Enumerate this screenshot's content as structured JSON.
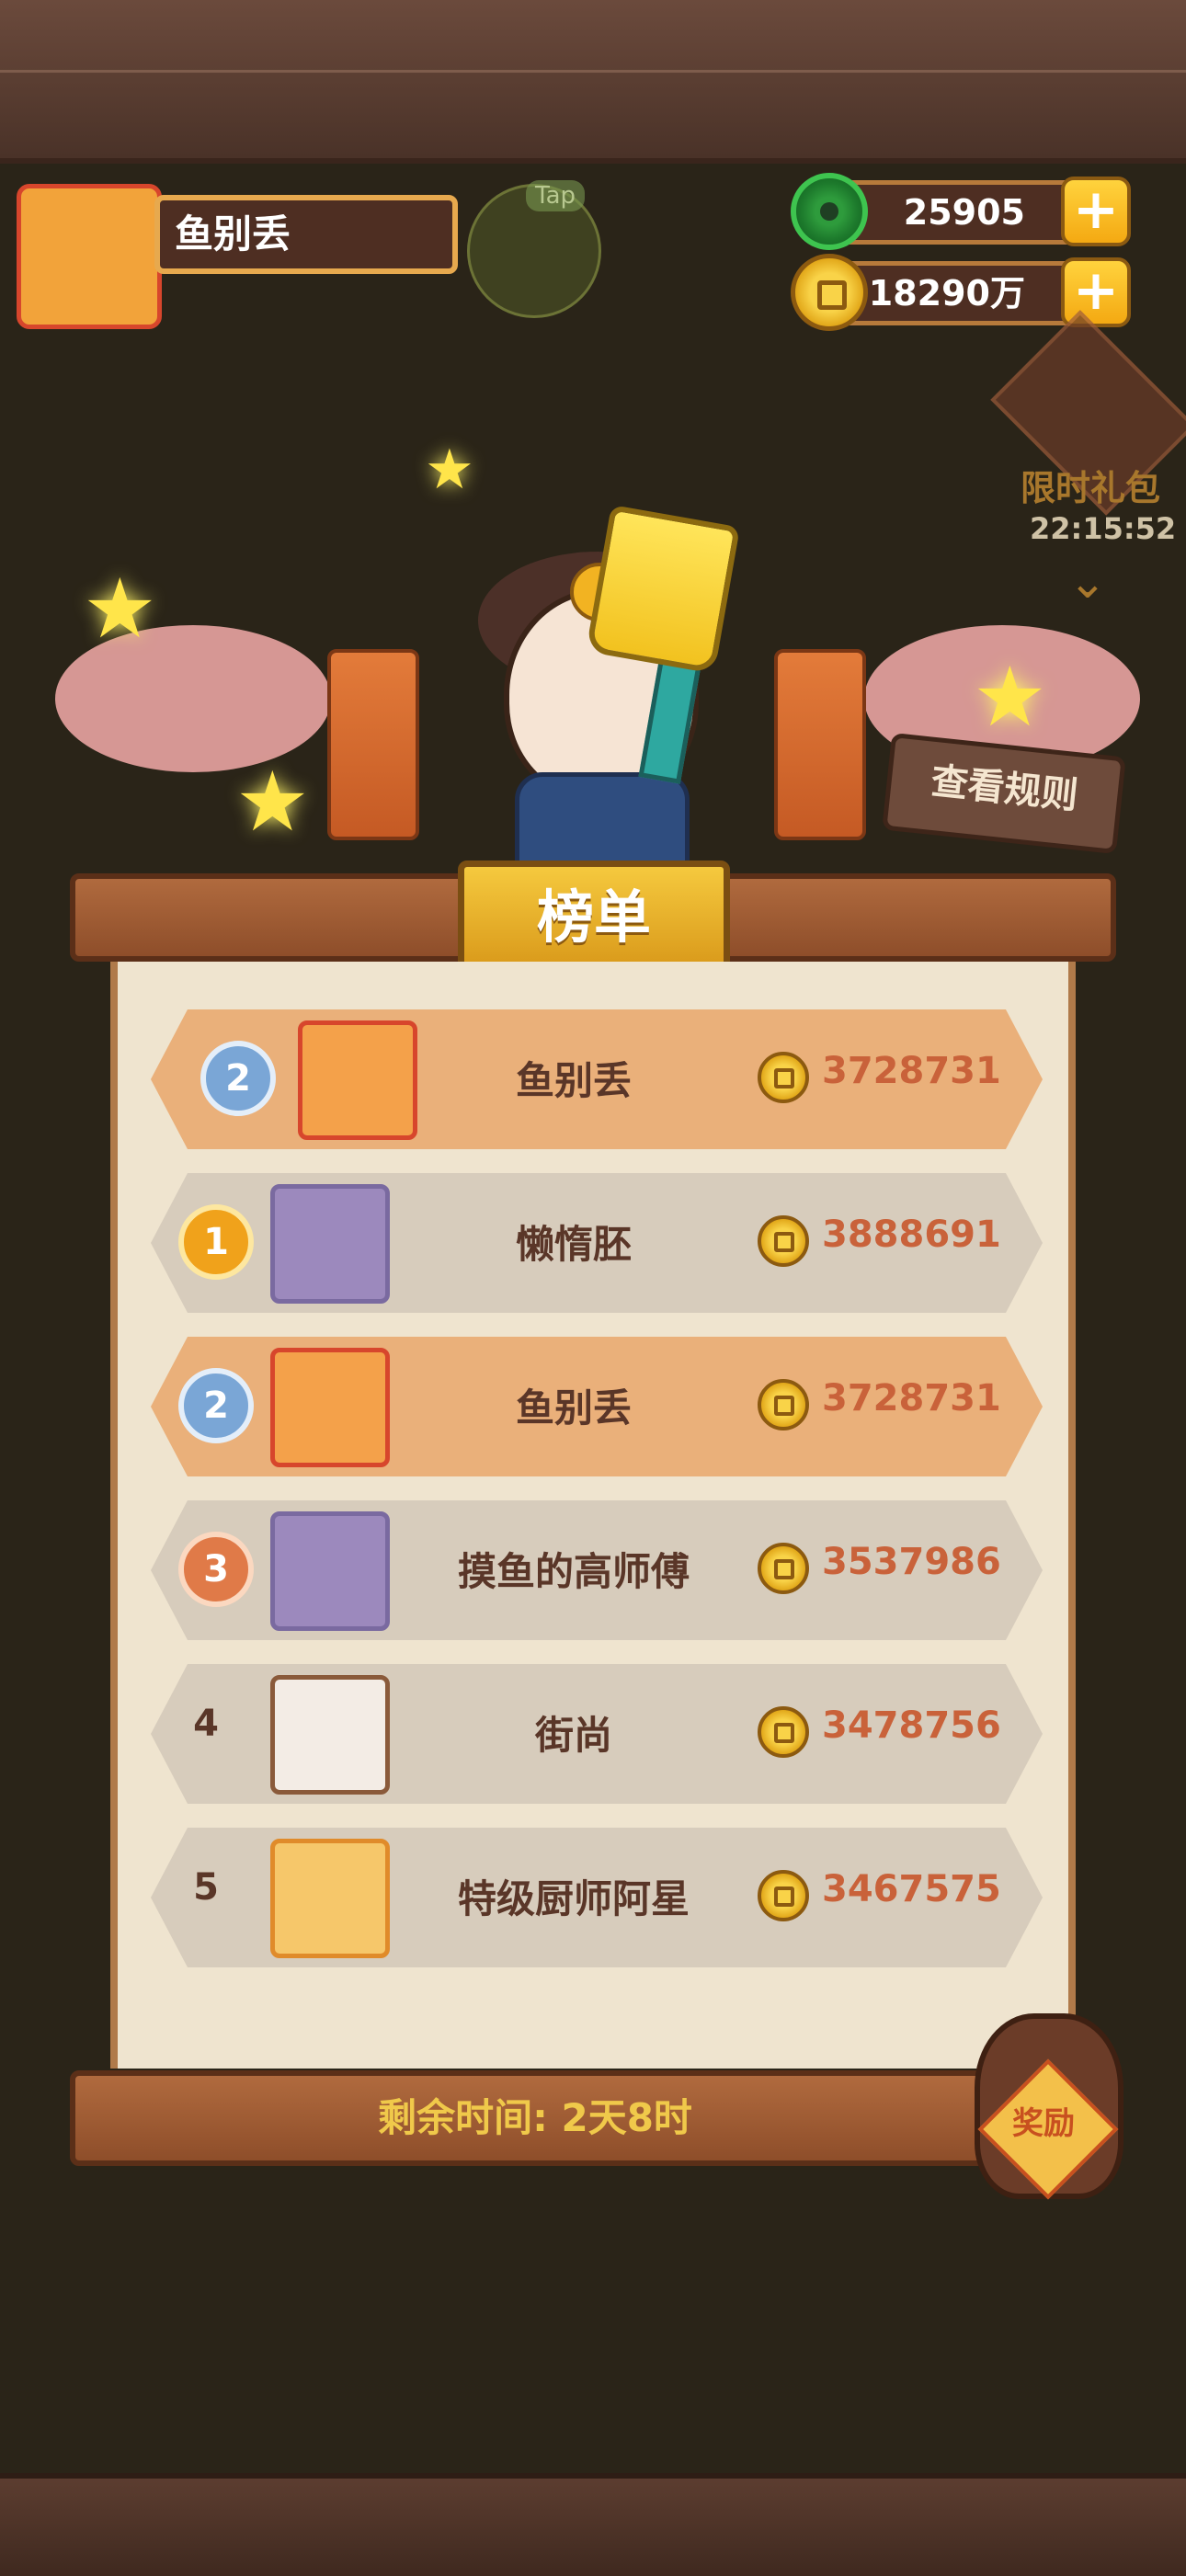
{
  "player": {
    "name": "鱼别丢",
    "tap_label": "Tap"
  },
  "currencies": {
    "jade": "25905",
    "coins": "18290万"
  },
  "gift": {
    "label": "限时礼包",
    "timer": "22:15:52"
  },
  "rules_button": "查看规则",
  "board": {
    "title": "榜单",
    "rows": [
      {
        "rank": "2",
        "medal": "silver",
        "name": "鱼别丢",
        "score": "3728731",
        "is_me": true,
        "avatar": "bear-avatar"
      },
      {
        "rank": "1",
        "medal": "gold",
        "name": "懒惰胚",
        "score": "3888691",
        "is_me": false,
        "avatar": "wolf-avatar"
      },
      {
        "rank": "2",
        "medal": "silver",
        "name": "鱼别丢",
        "score": "3728731",
        "is_me": true,
        "avatar": "bear-avatar"
      },
      {
        "rank": "3",
        "medal": "bronze",
        "name": "摸鱼的高师傅",
        "score": "3537986",
        "is_me": false,
        "avatar": "wolf-avatar"
      },
      {
        "rank": "4",
        "medal": "",
        "name": "街尚",
        "score": "3478756",
        "is_me": false,
        "avatar": "pig-avatar"
      },
      {
        "rank": "5",
        "medal": "",
        "name": "特级厨师阿星",
        "score": "3467575",
        "is_me": false,
        "avatar": "sink-avatar"
      }
    ],
    "remaining_time": "剩余时间: 2天8时",
    "reward_button": "奖励"
  },
  "colors": {
    "accent": "#f5c93e",
    "score": "#c9623a",
    "highlight_row": "#eab07a"
  }
}
